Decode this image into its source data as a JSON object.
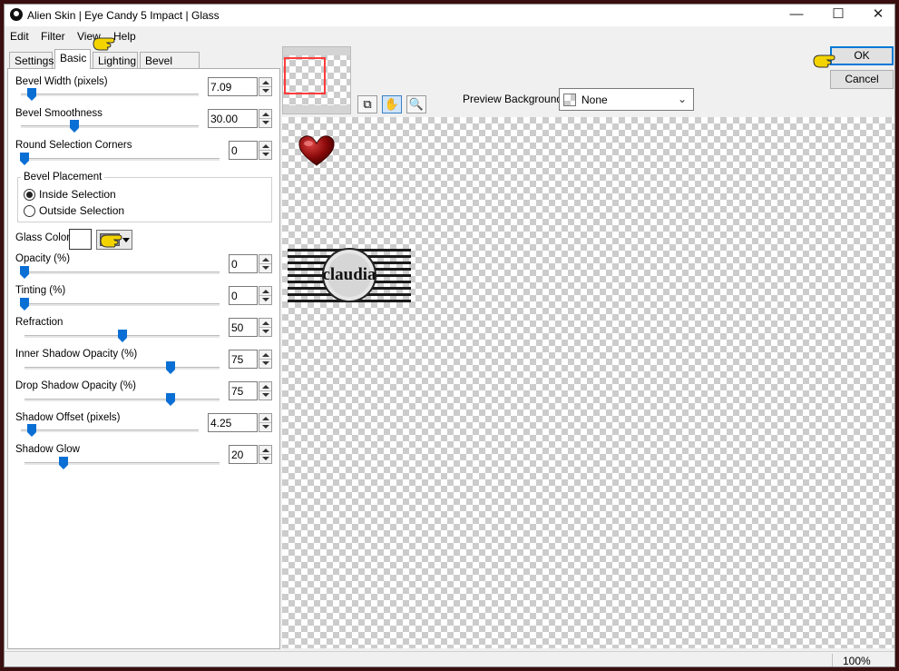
{
  "window": {
    "title": "Alien Skin | Eye Candy 5 Impact | Glass",
    "minimize": "—",
    "maximize": "☐",
    "close": "✕"
  },
  "menu": [
    "Edit",
    "Filter",
    "View",
    "Help"
  ],
  "tabs": [
    {
      "label": "Settings",
      "active": false
    },
    {
      "label": "Basic",
      "active": true
    },
    {
      "label": "Lighting",
      "active": false
    },
    {
      "label": "Bevel Profile",
      "active": false
    }
  ],
  "controls": {
    "bevel_width": {
      "label": "Bevel Width (pixels)",
      "value": "7.09",
      "slider_fraction": 0.06
    },
    "bevel_smoothness": {
      "label": "Bevel Smoothness",
      "value": "30.00",
      "slider_fraction": 0.3
    },
    "round_corners": {
      "label": "Round Selection Corners",
      "value": "0",
      "slider_fraction": 0.0
    },
    "bevel_placement": {
      "label": "Bevel Placement",
      "options": [
        {
          "label": "Inside Selection",
          "checked": true
        },
        {
          "label": "Outside Selection",
          "checked": false
        }
      ]
    },
    "glass_color": {
      "label": "Glass Color",
      "color": "#ffffff"
    },
    "opacity": {
      "label": "Opacity (%)",
      "value": "0",
      "slider_fraction": 0.0
    },
    "tinting": {
      "label": "Tinting (%)",
      "value": "0",
      "slider_fraction": 0.0
    },
    "refraction": {
      "label": "Refraction",
      "value": "50",
      "slider_fraction": 0.5
    },
    "inner_shadow": {
      "label": "Inner Shadow Opacity (%)",
      "value": "75",
      "slider_fraction": 0.75
    },
    "drop_shadow": {
      "label": "Drop Shadow Opacity (%)",
      "value": "75",
      "slider_fraction": 0.75
    },
    "shadow_offset": {
      "label": "Shadow Offset (pixels)",
      "value": "4.25",
      "slider_fraction": 0.06
    },
    "shadow_glow": {
      "label": "Shadow Glow",
      "value": "20",
      "slider_fraction": 0.2
    }
  },
  "preview": {
    "background_label": "Preview Background:",
    "background_value": "None",
    "stamp_text": "claudia"
  },
  "buttons": {
    "ok": "OK",
    "cancel": "Cancel"
  },
  "status": {
    "zoom": "100%"
  },
  "colors": {
    "accent": "#0a6fd4",
    "heart": "#8b0a0a",
    "frame": "#3a0f0f"
  }
}
